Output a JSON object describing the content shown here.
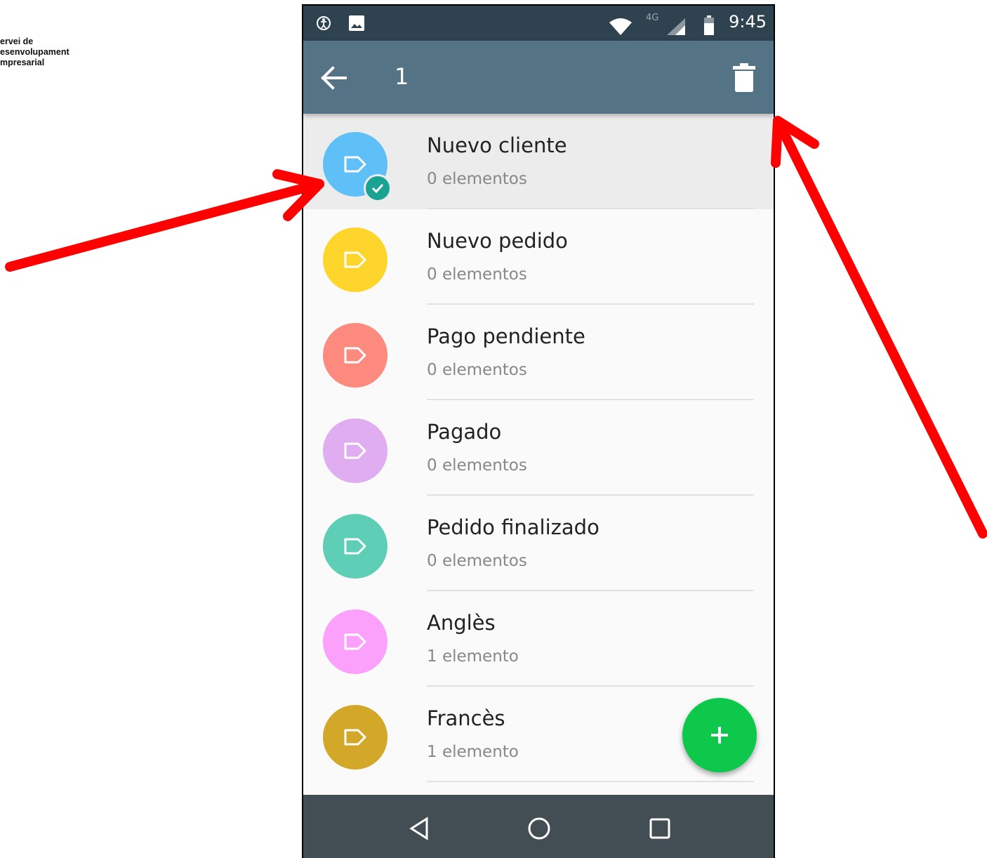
{
  "brand": {
    "lines": [
      "ervei de",
      "esenvolupament",
      "mpresarial"
    ]
  },
  "status_bar": {
    "time": "9:45",
    "network": "4G",
    "icons": [
      "accessibility-icon",
      "image-icon",
      "wifi-icon",
      "signal-icon",
      "battery-icon"
    ]
  },
  "app_bar": {
    "selected_count": "1",
    "back_icon": "arrow-back-icon",
    "delete_icon": "trash-icon"
  },
  "labels": [
    {
      "title": "Nuevo cliente",
      "count": "0 elementos",
      "color": "#5fc0f8",
      "selected": true
    },
    {
      "title": "Nuevo pedido",
      "count": "0 elementos",
      "color": "#fdd52b",
      "selected": false
    },
    {
      "title": "Pago pendiente",
      "count": "0 elementos",
      "color": "#fd8a7f",
      "selected": false
    },
    {
      "title": "Pagado",
      "count": "0 elementos",
      "color": "#dfadf0",
      "selected": false
    },
    {
      "title": "Pedido finalizado",
      "count": "0 elementos",
      "color": "#5ecfb6",
      "selected": false
    },
    {
      "title": "Anglès",
      "count": "1 elemento",
      "color": "#fba0fb",
      "selected": false
    },
    {
      "title": "Francès",
      "count": "1 elemento",
      "color": "#d3a828",
      "selected": false
    }
  ],
  "fab": {
    "icon": "plus-icon",
    "color": "#0dc84a"
  },
  "nav_bar": {
    "buttons": [
      "back-triangle-icon",
      "home-circle-icon",
      "recents-square-icon"
    ]
  },
  "annotation_color": "#ff0000"
}
